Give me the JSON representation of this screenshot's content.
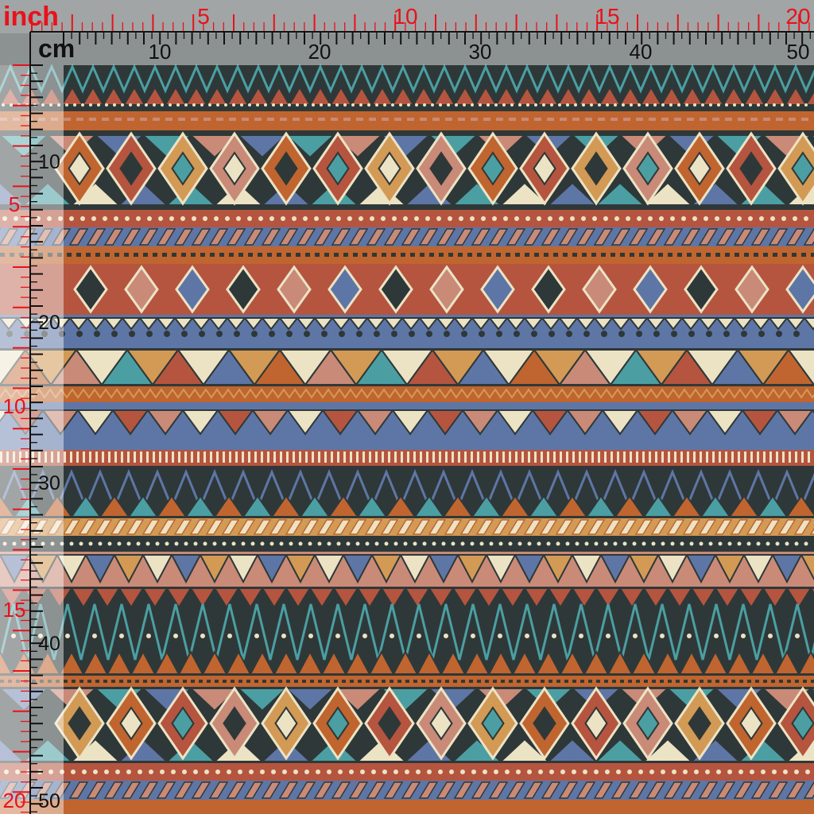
{
  "units": {
    "inch_label": "inch",
    "cm_label": "cm"
  },
  "ruler": {
    "inch_numbers": [
      "5",
      "10",
      "15",
      "20"
    ],
    "cm_numbers": [
      "10",
      "20",
      "30",
      "40",
      "50"
    ]
  },
  "colors": {
    "ruler_red": "#e8121b",
    "ruler_black": "#111111",
    "ruler_overlay": "#ffffff",
    "terracotta": "#b5553f",
    "rust": "#c0652f",
    "teal": "#4b9fa3",
    "slate_blue": "#5e76a6",
    "cream": "#ece3c5",
    "charcoal": "#2f3838",
    "dusty_rose": "#c98a78",
    "ochre": "#d29a55"
  }
}
